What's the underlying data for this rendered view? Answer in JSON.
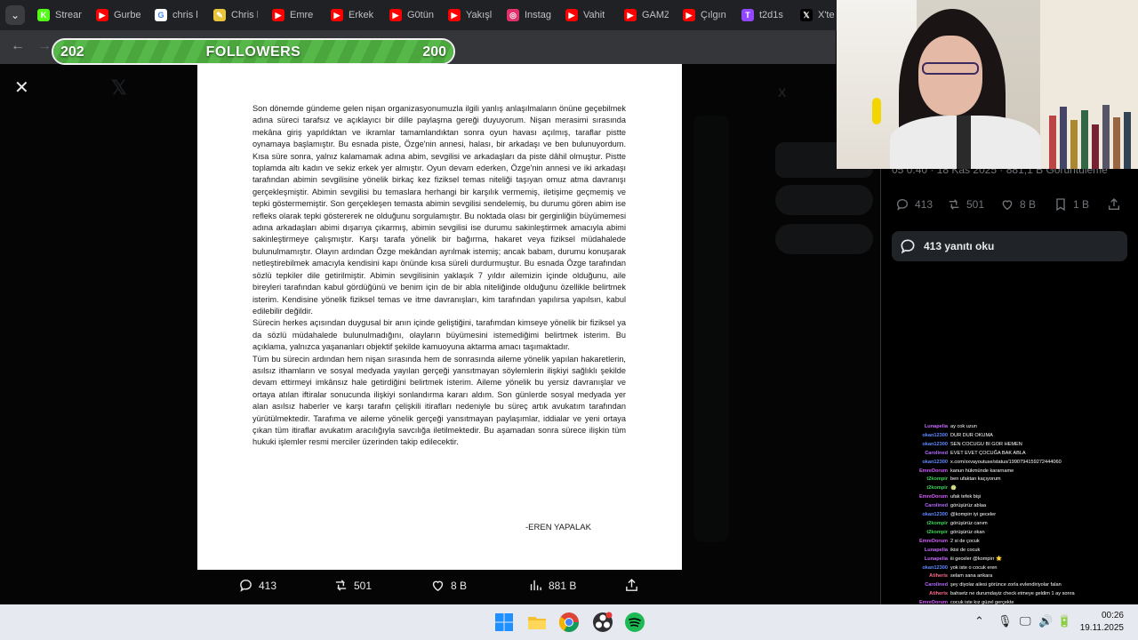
{
  "browser": {
    "tab_menu_icon": "chevron-down-icon",
    "tabs": [
      {
        "label": "Stream",
        "icon": "kick-icon",
        "color": "#53fc18",
        "glyph": "K"
      },
      {
        "label": "Gurbe",
        "icon": "youtube-icon",
        "color": "#ff0000",
        "glyph": "▶"
      },
      {
        "label": "chris l",
        "icon": "google-icon",
        "color": "#ffffff",
        "glyph": "G"
      },
      {
        "label": "Chris l",
        "icon": "page-icon",
        "color": "#e8c53a",
        "glyph": "✎"
      },
      {
        "label": "Emre",
        "icon": "youtube-icon",
        "color": "#ff0000",
        "glyph": "▶"
      },
      {
        "label": "Erkek",
        "icon": "youtube-icon",
        "color": "#ff0000",
        "glyph": "▶"
      },
      {
        "label": "G0tün",
        "icon": "youtube-icon",
        "color": "#ff0000",
        "glyph": "▶"
      },
      {
        "label": "Yakışl",
        "icon": "youtube-icon",
        "color": "#ff0000",
        "glyph": "▶"
      },
      {
        "label": "Instag",
        "icon": "instagram-icon",
        "color": "#e1306c",
        "glyph": "◎"
      },
      {
        "label": "Vahit",
        "icon": "youtube-icon",
        "color": "#ff0000",
        "glyph": "▶"
      },
      {
        "label": "GAMZ",
        "icon": "youtube-icon",
        "color": "#ff0000",
        "glyph": "▶"
      },
      {
        "label": "Çılgın",
        "icon": "youtube-icon",
        "color": "#ff0000",
        "glyph": "▶"
      },
      {
        "label": "t2d1s",
        "icon": "twitch-icon",
        "color": "#9146ff",
        "glyph": "T"
      },
      {
        "label": "X'te",
        "icon": "x-icon",
        "color": "#000000",
        "glyph": "𝕏"
      }
    ]
  },
  "followers_bar": {
    "left_value": "202",
    "title": "FOLLOWERS",
    "right_value": "200",
    "progress": 1.0
  },
  "document": {
    "paragraphs": [
      "Son dönemde gündeme gelen nişan organizasyonumuzla ilgili yanlış anlaşılmaların önüne geçebilmek adına süreci tarafsız ve açıklayıcı bir dille paylaşma gereği duyuyorum. Nişan merasimi sırasında mekâna giriş yapıldıktan ve ikramlar tamamlandıktan sonra oyun havası açılmış, taraflar pistte oynamaya başlamıştır. Bu esnada piste, Özge'nin annesi, halası, bir arkadaşı ve ben bulunuyordum. Kısa süre sonra, yalnız kalamamak adına abim, sevgilisi ve arkadaşları da piste dâhil olmuştur. Pistte toplamda altı kadın ve sekiz erkek yer almıştır. Oyun devam ederken, Özge'nin annesi ve iki arkadaşı tarafından abimin sevgilisine yönelik birkaç kez fiziksel temas niteliği taşıyan omuz atma davranışı gerçekleşmiştir. Abimin sevgilisi bu temaslara herhangi bir karşılık vermemiş, iletişime geçmemiş ve tepki göstermemiştir. Son gerçekleşen temasta abimin sevgilisi sendelemiş, bu durumu gören abim ise refleks olarak tepki göstererek ne olduğunu sorgulamıştır. Bu noktada olası bir gerginliğin büyümemesi adına arkadaşları abimi dışarıya çıkarmış, abimin sevgilisi ise durumu sakinleştirmek amacıyla abimi sakinleştirmeye çalışmıştır. Karşı tarafa yönelik bir bağırma, hakaret veya fiziksel müdahalede bulunulmamıştır. Olayın ardından Özge mekândan ayrılmak istemiş; ancak babam, durumu konuşarak netleştirebilmek amacıyla kendisini kapı önünde kısa süreli durdurmuştur. Bu esnada Özge tarafından sözlü tepkiler dile getirilmiştir. Abimin sevgilisinin yaklaşık 7 yıldır ailemizin içinde olduğunu, aile bireyleri tarafından kabul gördüğünü ve benim için de bir abla niteliğinde olduğunu özellikle belirtmek isterim. Kendisine yönelik fiziksel temas ve itme davranışları, kim tarafından yapılırsa yapılsın, kabul edilebilir değildir.",
      " Sürecin herkes açısından duygusal bir anın içinde geliştiğini, tarafımdan kimseye yönelik bir fiziksel ya da sözlü müdahalede bulunulmadığını, olayların büyümesini istemediğimi belirtmek isterim. Bu açıklama, yalnızca yaşananları objektif şekilde kamuoyuna aktarma amacı taşımaktadır.",
      "Tüm bu sürecin ardından hem nişan sırasında hem de sonrasında aileme yönelik yapılan hakaretlerin, asılsız ithamların ve sosyal medyada yayılan gerçeği yansıtmayan söylemlerin ilişkiyi sağlıklı şekilde devam ettirmeyi imkânsız hale getirdiğini belirtmek isterim. Aileme yönelik bu yersiz davranışlar ve ortaya atılan iftiralar sonucunda ilişkiyi sonlandırma kararı aldım.  Son günlerde sosyal medyada yer alan asılsız haberler ve karşı tarafın çelişkili itirafları nedeniyle bu süreç artık avukatım tarafından yürütülmektedir. Tarafıma ve aileme yönelik gerçeği yansıtmayan paylaşımlar, iddialar ve yeni ortaya çıkan tüm itiraflar avukatım aracılığıyla savcılığa iletilmektedir. Bu aşamadan sonra sürece ilişkin tüm hukuki işlemler resmi merciler üzerinden takip edilecektir."
    ],
    "signature": "-EREN YAPALAK"
  },
  "media_actions": {
    "replies": "413",
    "reposts": "501",
    "likes": "8 B",
    "views": "881 B"
  },
  "tweet_panel": {
    "stats_line": "05 0.40 · 18 Kas 2025 · 881,1 B Görüntüleme",
    "replies": "413",
    "reposts": "501",
    "likes": "8 B",
    "bookmarks": "1 B",
    "read_replies": "413 yanıtı oku"
  },
  "chat": [
    {
      "user": "Lunapelia",
      "color": "#c86bff",
      "msg": "ay cok uzun"
    },
    {
      "user": "okan12300",
      "color": "#5f8cff",
      "msg": "DUR DUR OKUMA"
    },
    {
      "user": "okan12300",
      "color": "#5f8cff",
      "msg": "SEN COCUGU BI GOR HEMEN"
    },
    {
      "user": "Carolined",
      "color": "#b36bff",
      "msg": "EVET EVET ÇOCUĞA BAK ABLA"
    },
    {
      "user": "okan12300",
      "color": "#5f8cff",
      "msg": "x.com/xxvayoutuse/status/1990794159272444060"
    },
    {
      "user": "EmreDorum",
      "color": "#d65cff",
      "msg": "kanun hükmünde kararname"
    },
    {
      "user": "t2kompir",
      "color": "#39d353",
      "msg": "ben ufaktan kaçıyorum"
    },
    {
      "user": "t2kompir",
      "color": "#39d353",
      "msg": "🍈"
    },
    {
      "user": "EmreDorum",
      "color": "#d65cff",
      "msg": "ufak tefek bişi"
    },
    {
      "user": "Carolined",
      "color": "#b36bff",
      "msg": "görüşürüz ablaa"
    },
    {
      "user": "okan12300",
      "color": "#5f8cff",
      "msg": "@kompirr iyi geceler"
    },
    {
      "user": "t2kompir",
      "color": "#39d353",
      "msg": "görüşürüz canım"
    },
    {
      "user": "t2kompir",
      "color": "#39d353",
      "msg": "görüşürüz okan"
    },
    {
      "user": "EmreDorum",
      "color": "#d65cff",
      "msg": "2 si de çocuk"
    },
    {
      "user": "Lunapelia",
      "color": "#c86bff",
      "msg": "ikisi de cocuk"
    },
    {
      "user": "Lunapelia",
      "color": "#c86bff",
      "msg": "iii geceler @kompirr 🌟"
    },
    {
      "user": "okan12300",
      "color": "#5f8cff",
      "msg": "yok iste o cocuk eren"
    },
    {
      "user": "Atiheris",
      "color": "#ff6a8b",
      "msg": "selam sana ankara"
    },
    {
      "user": "Carolined",
      "color": "#b36bff",
      "msg": "şey diyolar ailesi görünce zorla evlendiriyolar falan"
    },
    {
      "user": "Atiheris",
      "color": "#ff6a8b",
      "msg": "bahsetz ne durumdayiz check etmeye geldim 1 ay sonra"
    },
    {
      "user": "EmreDorum",
      "color": "#d65cff",
      "msg": "cocuk iste kız güzel gerçekte"
    }
  ],
  "taskbar": {
    "time": "00:26",
    "date": "19.11.2025",
    "apps": [
      "windows-start-icon",
      "file-explorer-icon",
      "chrome-icon",
      "obs-icon",
      "spotify-icon"
    ]
  }
}
